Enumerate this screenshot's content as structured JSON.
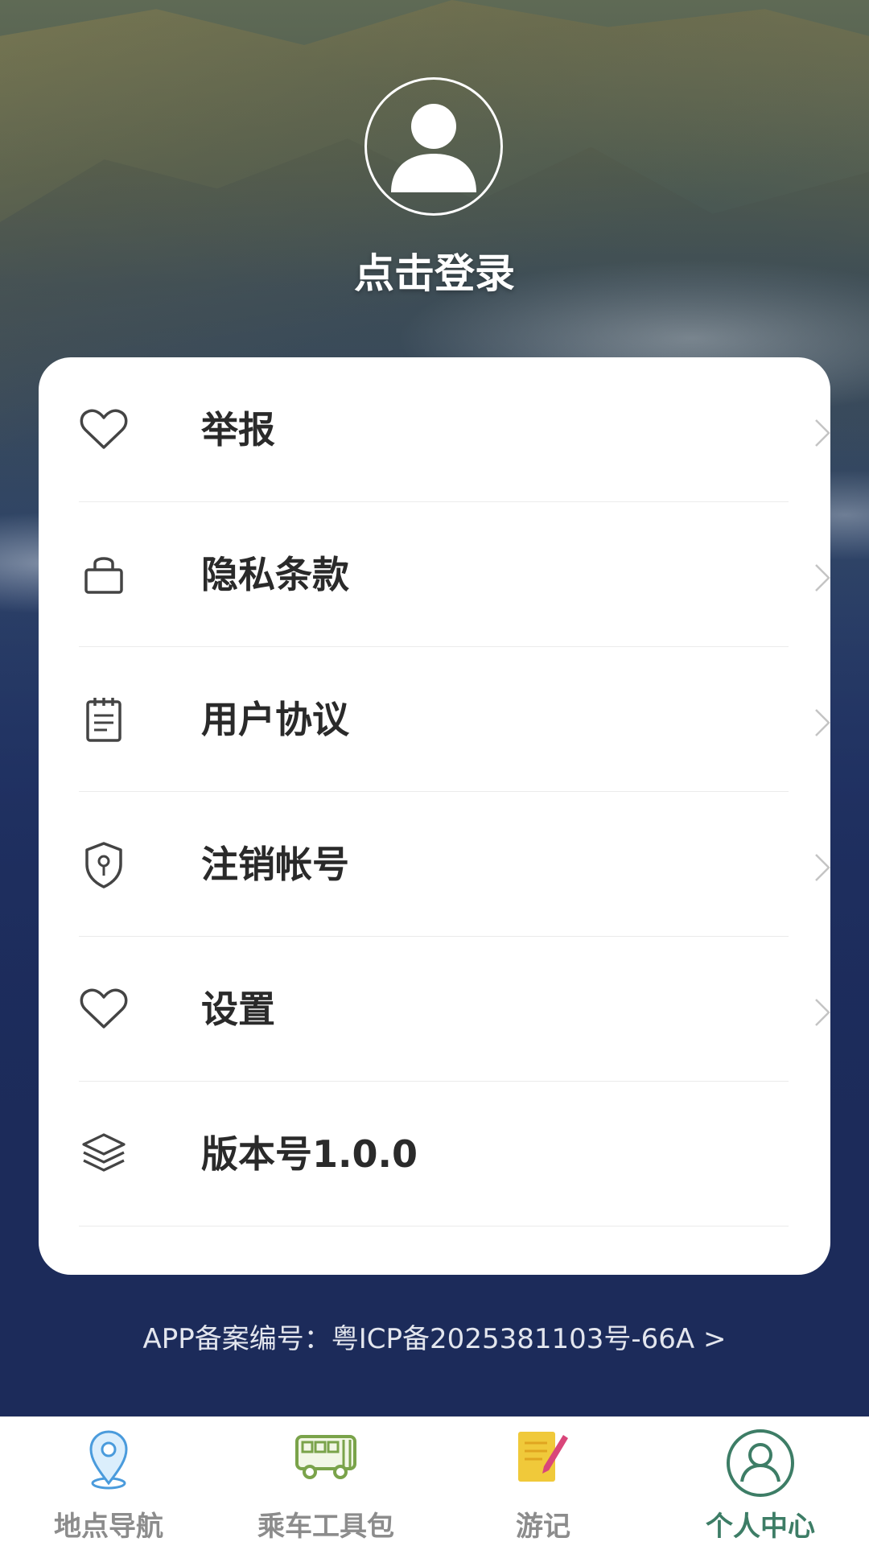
{
  "profile": {
    "login_text": "点击登录"
  },
  "menu": {
    "items": [
      {
        "label": "举报",
        "icon": "heart-icon"
      },
      {
        "label": "隐私条款",
        "icon": "lock-icon"
      },
      {
        "label": "用户协议",
        "icon": "notepad-icon"
      },
      {
        "label": "注销帐号",
        "icon": "shield-keyhole-icon"
      },
      {
        "label": "设置",
        "icon": "heart-icon"
      },
      {
        "label": "版本号1.0.0",
        "icon": "layers-icon"
      }
    ]
  },
  "icp": {
    "text": "APP备案编号：粤ICP备2025381103号-66A >"
  },
  "tabbar": {
    "tabs": [
      {
        "label": "地点导航",
        "icon": "location-pin-icon"
      },
      {
        "label": "乘车工具包",
        "icon": "bus-icon"
      },
      {
        "label": "游记",
        "icon": "notebook-pen-icon"
      },
      {
        "label": "个人中心",
        "icon": "user-icon",
        "active": true
      }
    ],
    "active_color": "#3d7d66",
    "inactive_color": "#8c8c8c"
  }
}
